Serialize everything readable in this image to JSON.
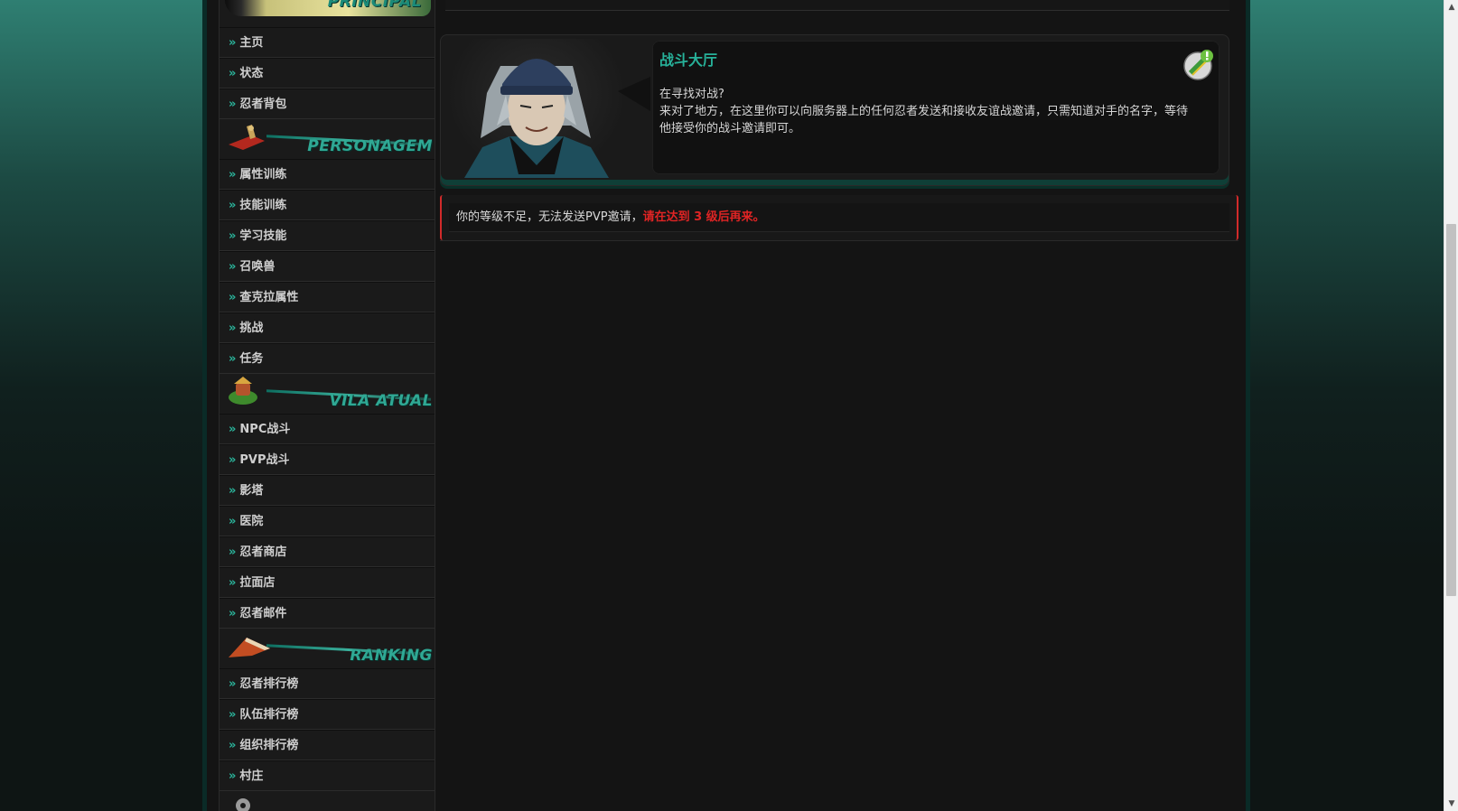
{
  "sidebar": {
    "sections": [
      {
        "title": "PRINCIPAL",
        "items": [
          "主页",
          "状态",
          "忍者背包"
        ]
      },
      {
        "title": "PERSONAGEM",
        "items": [
          "属性训练",
          "技能训练",
          "学习技能",
          "召唤兽",
          "查克拉属性",
          "挑战",
          "任务"
        ]
      },
      {
        "title": "VILA ATUAL",
        "items": [
          "NPC战斗",
          "PVP战斗",
          "影塔",
          "医院",
          "忍者商店",
          "拉面店",
          "忍者邮件"
        ]
      },
      {
        "title": "RANKING",
        "items": [
          "忍者排行榜",
          "队伍排行榜",
          "组织排行榜",
          "村庄"
        ]
      }
    ],
    "arrow": "»"
  },
  "intro": {
    "title": "战斗大厅",
    "line1": "在寻找对战?",
    "line2": "来对了地方，在这里你可以向服务器上的任何忍者发送和接收友谊战邀请，只需知道对手的名字，等待他接受你的战斗邀请即可。"
  },
  "alert": {
    "text": "你的等级不足，无法发送PVP邀请，",
    "highlight": "请在达到 3 级后再来。"
  },
  "scrollbar": {
    "up": "▲",
    "down": "▼"
  },
  "colors": {
    "accent": "#27b29a",
    "alert": "#e02424"
  }
}
